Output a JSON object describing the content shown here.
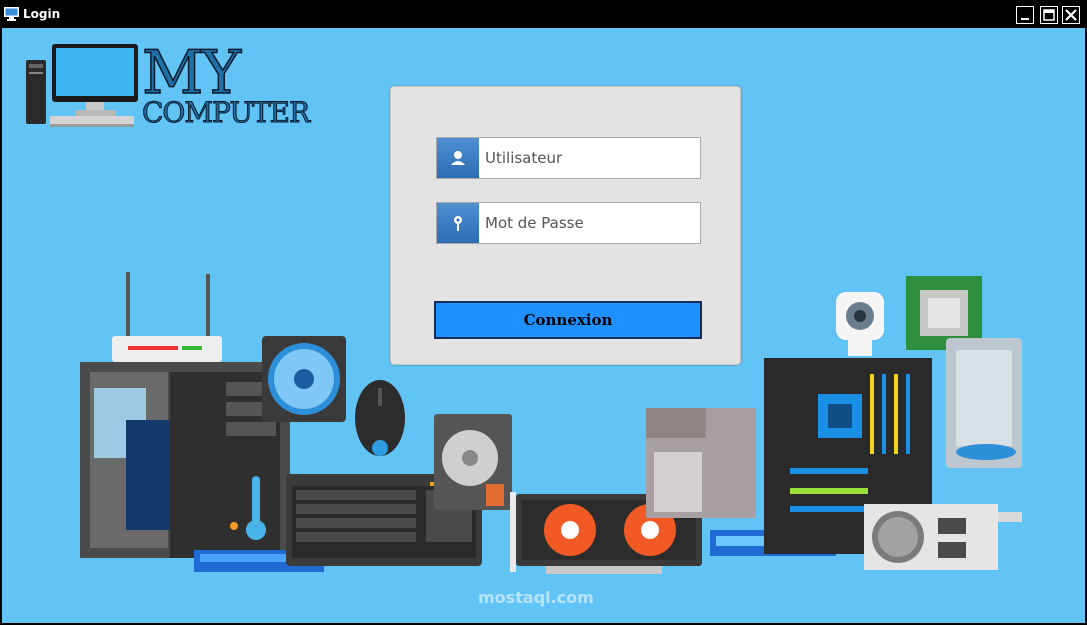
{
  "window": {
    "title": "Login",
    "controls": {
      "minimize": "minimize",
      "maximize": "maximize",
      "close": "close"
    }
  },
  "logo": {
    "line1": "MY",
    "line2": "COMPUTER"
  },
  "form": {
    "username_placeholder": "Utilisateur",
    "password_placeholder": "Mot de Passe",
    "connect_label": "Connexion"
  },
  "watermark": "mostaql.com",
  "colors": {
    "background": "#62c4f5",
    "panel": "#e3e3e3",
    "button": "#1e90ff",
    "icon_box": "#3a7cc2"
  }
}
